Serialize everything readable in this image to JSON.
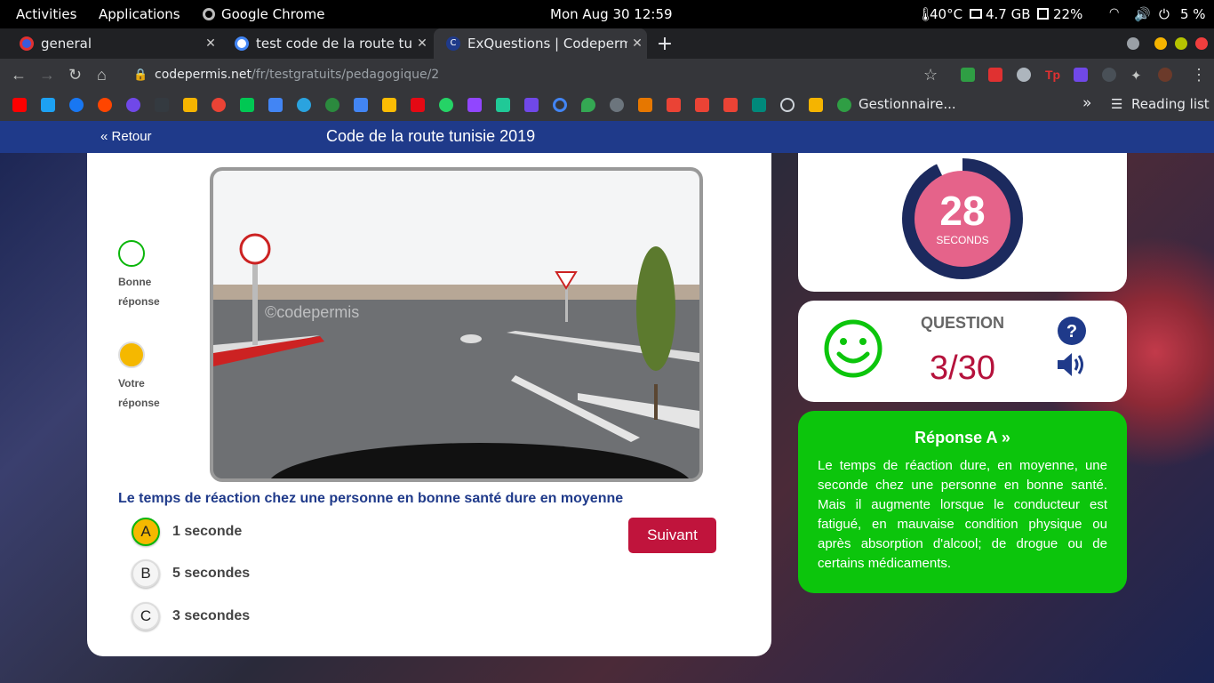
{
  "system_bar": {
    "activities": "Activities",
    "applications": "Applications",
    "app_name": "Google Chrome",
    "datetime": "Mon Aug 30  12:59",
    "temperature": "40°C",
    "memory": "4.7 GB",
    "storage": "22%",
    "battery": "5 %"
  },
  "tabs": [
    {
      "title": "general",
      "active": false
    },
    {
      "title": "test code de la route tunisie",
      "active": false
    },
    {
      "title": "ExQuestions | Codepermis",
      "active": true
    }
  ],
  "address_bar": {
    "domain": "codepermis.net",
    "path": "/fr/testgratuits/pedagogique/2"
  },
  "bookmarks": {
    "folder_label": "Gestionnaire...",
    "overflow": "»",
    "reading_list": "Reading list"
  },
  "page_nav": {
    "back_label": "Retour",
    "title": "Code de la route tunisie 2019"
  },
  "legend": {
    "correct_label": "Bonne réponse",
    "yours_label": "Votre réponse",
    "correct_color": "#0ab60a",
    "yours_color": "#f5b800"
  },
  "question": {
    "watermark": "©codepermis",
    "text": "Le temps de réaction chez une personne en bonne santé dure en moyenne",
    "options": [
      {
        "letter": "A",
        "text": "1 seconde",
        "selected": true
      },
      {
        "letter": "B",
        "text": "5 secondes",
        "selected": false
      },
      {
        "letter": "C",
        "text": "3 secondes",
        "selected": false
      }
    ],
    "next_label": "Suivant"
  },
  "timer": {
    "value": "28",
    "unit": "SECONDS",
    "progress_fraction": 0.93
  },
  "progress": {
    "label": "QUESTION",
    "value": "3/30"
  },
  "answer": {
    "title": "Réponse A",
    "explanation": "Le temps de réaction dure, en moyenne, une seconde chez une personne en bonne santé. Mais il augmente lorsque le conducteur est fatigué, en mauvaise condition physique ou après absorption d'alcool; de drogue ou de certains médicaments."
  },
  "colors": {
    "nav_blue": "#1f3a8a",
    "accent_red": "#c0143c",
    "answer_green": "#0cc50c",
    "timer_pink": "#e5638a",
    "timer_ring": "#1c2a5e"
  }
}
